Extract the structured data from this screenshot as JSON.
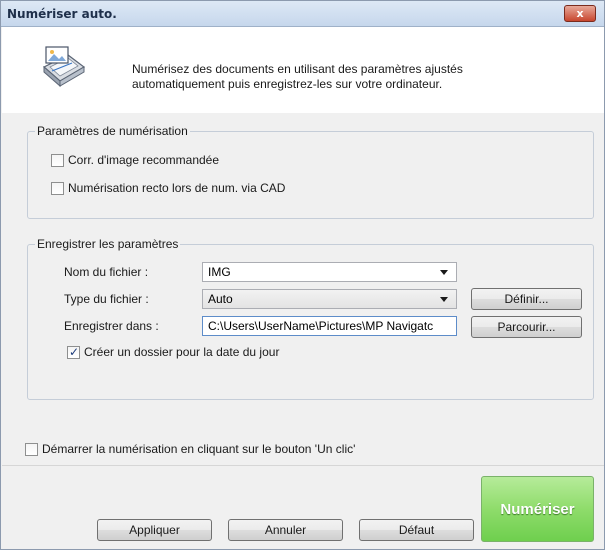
{
  "window": {
    "title": "Numériser auto.",
    "close_label": "x"
  },
  "header": {
    "icon": "scanner-icon",
    "description_line1": "Numérisez des documents en utilisant des paramètres ajustés",
    "description_line2": "automatiquement puis enregistrez-les sur votre ordinateur."
  },
  "scan_settings": {
    "legend": "Paramètres de numérisation",
    "recommended_correction": {
      "label": "Corr. d'image recommandée",
      "checked": false
    },
    "simplex_via_adf": {
      "label": "Numérisation recto lors de num. via CAD",
      "checked": false
    }
  },
  "save_settings": {
    "legend": "Enregistrer les paramètres",
    "file_name_label": "Nom du fichier :",
    "file_name_value": "IMG",
    "file_type_label": "Type du fichier :",
    "file_type_value": "Auto",
    "define_button": "Définir...",
    "save_in_label": "Enregistrer dans :",
    "save_in_value": "C:\\Users\\UserName\\Pictures\\MP Navigatc",
    "browse_button": "Parcourir...",
    "create_date_folder": {
      "label": "Créer un dossier pour la date du jour",
      "checked": true
    }
  },
  "one_click": {
    "label": "Démarrer la numérisation en cliquant sur le bouton 'Un clic'",
    "checked": false
  },
  "footer": {
    "apply": "Appliquer",
    "cancel": "Annuler",
    "default": "Défaut",
    "scan": "Numériser"
  },
  "colors": {
    "scan_button": "#8fdc6b",
    "titlebar": "#c6d7ec"
  }
}
